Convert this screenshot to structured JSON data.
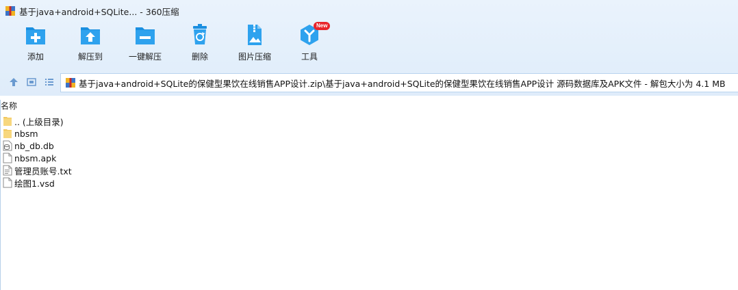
{
  "window": {
    "title": "基于java+android+SQLite... - 360压缩"
  },
  "toolbar": {
    "items": [
      {
        "label": "添加",
        "icon": "add-folder-icon"
      },
      {
        "label": "解压到",
        "icon": "extract-to-icon"
      },
      {
        "label": "一键解压",
        "icon": "one-click-extract-icon"
      },
      {
        "label": "删除",
        "icon": "recycle-bin-icon"
      },
      {
        "label": "图片压缩",
        "icon": "image-compress-icon"
      },
      {
        "label": "工具",
        "icon": "tools-icon",
        "badge": "New"
      }
    ]
  },
  "address": {
    "path": "基于java+android+SQLite的保健型果饮在线销售APP设计.zip\\基于java+android+SQLite的保健型果饮在线销售APP设计 源码数据库及APK文件 - 解包大小为 4.1 MB"
  },
  "list": {
    "column_name": "名称",
    "files": [
      {
        "name": ".. (上级目录)",
        "icon": "folder-icon"
      },
      {
        "name": "nbsm",
        "icon": "folder-icon"
      },
      {
        "name": "nb_db.db",
        "icon": "db-file-icon"
      },
      {
        "name": "nbsm.apk",
        "icon": "file-icon"
      },
      {
        "name": "管理员账号.txt",
        "icon": "text-file-icon"
      },
      {
        "name": "绘图1.vsd",
        "icon": "file-icon"
      }
    ]
  },
  "colors": {
    "accent": "#1a8fe0",
    "chrome_bg": "#e3effb",
    "badge": "#e8242a"
  }
}
